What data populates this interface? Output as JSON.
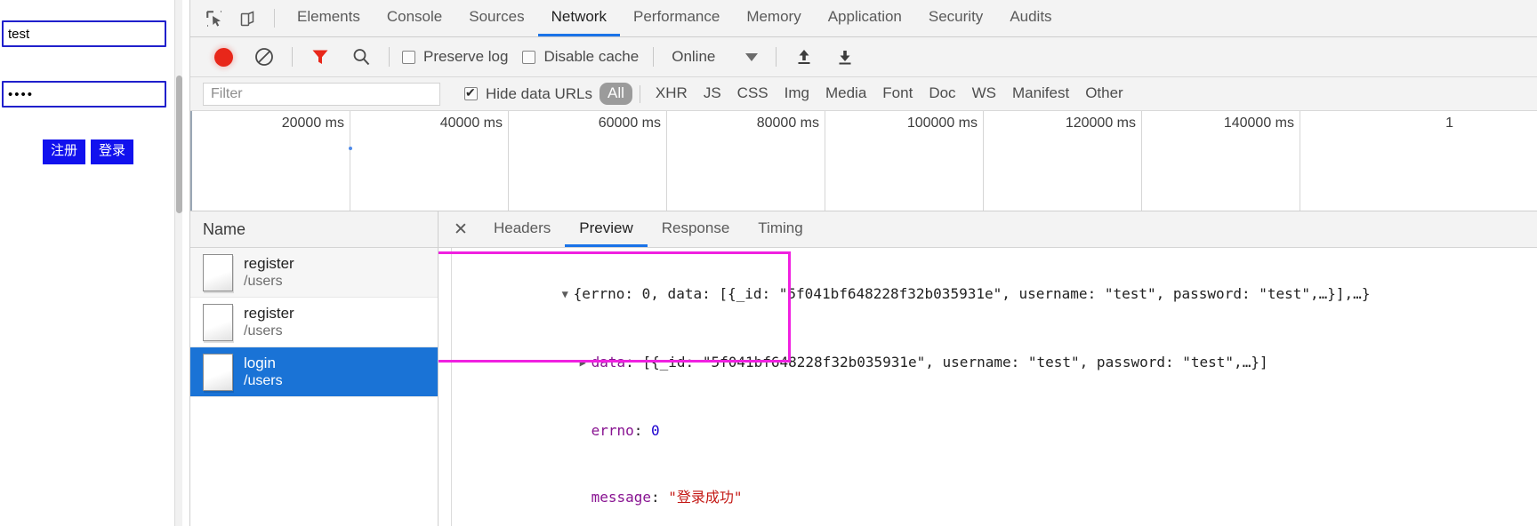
{
  "page": {
    "username_value": "test",
    "username_placeholder": "",
    "password_value": "••••",
    "password_placeholder": "",
    "register_button": "注册",
    "login_button": "登录"
  },
  "devtools": {
    "icons": {
      "inspect": "inspect-element-icon",
      "device": "device-toolbar-icon",
      "record": "record-icon",
      "clear": "clear-icon",
      "filter": "filter-funnel-icon",
      "search": "search-icon",
      "import": "import-har-icon",
      "export": "export-har-icon",
      "close": "close-icon"
    },
    "tabs": [
      {
        "label": "Elements",
        "active": false
      },
      {
        "label": "Console",
        "active": false
      },
      {
        "label": "Sources",
        "active": false
      },
      {
        "label": "Network",
        "active": true
      },
      {
        "label": "Performance",
        "active": false
      },
      {
        "label": "Memory",
        "active": false
      },
      {
        "label": "Application",
        "active": false
      },
      {
        "label": "Security",
        "active": false
      },
      {
        "label": "Audits",
        "active": false
      }
    ],
    "toolbar": {
      "preserve_log_label": "Preserve log",
      "preserve_log_checked": false,
      "disable_cache_label": "Disable cache",
      "disable_cache_checked": false,
      "throttle_value": "Online"
    },
    "filter_row": {
      "filter_placeholder": "Filter",
      "filter_value": "",
      "hide_data_urls_label": "Hide data URLs",
      "hide_data_urls_checked": true,
      "types": [
        {
          "label": "All",
          "active": true
        },
        {
          "label": "XHR",
          "active": false
        },
        {
          "label": "JS",
          "active": false
        },
        {
          "label": "CSS",
          "active": false
        },
        {
          "label": "Img",
          "active": false
        },
        {
          "label": "Media",
          "active": false
        },
        {
          "label": "Font",
          "active": false
        },
        {
          "label": "Doc",
          "active": false
        },
        {
          "label": "WS",
          "active": false
        },
        {
          "label": "Manifest",
          "active": false
        },
        {
          "label": "Other",
          "active": false
        }
      ]
    },
    "timeline": {
      "ticks": [
        "20000 ms",
        "40000 ms",
        "60000 ms",
        "80000 ms",
        "100000 ms",
        "120000 ms",
        "140000 ms",
        "1"
      ]
    },
    "requests": {
      "column_header": "Name",
      "rows": [
        {
          "name": "register",
          "path": "/users",
          "selected": false
        },
        {
          "name": "register",
          "path": "/users",
          "selected": false
        },
        {
          "name": "login",
          "path": "/users",
          "selected": true
        }
      ]
    },
    "detail": {
      "tabs": [
        {
          "label": "Headers",
          "active": false
        },
        {
          "label": "Preview",
          "active": true
        },
        {
          "label": "Response",
          "active": false
        },
        {
          "label": "Timing",
          "active": false
        }
      ],
      "preview": {
        "root_line": {
          "arrow": "▼",
          "text": "{errno: 0, data: [{_id: \"5f041bf648228f32b035931e\", username: \"test\", password: \"test\",…}],…}"
        },
        "data_line": {
          "arrow": "▶",
          "key": "data",
          "text": ": [{_id: \"5f041bf648228f32b035931e\", username: \"test\", password: \"test\",…}]"
        },
        "errno_line": {
          "key": "errno",
          "sep": ": ",
          "value": "0"
        },
        "message_line": {
          "key": "message",
          "sep": ": ",
          "value": "\"登录成功\""
        }
      }
    }
  },
  "colors": {
    "accent_blue": "#1a73e8",
    "selection_blue": "#1a73d6",
    "record_red": "#e8271a",
    "highlight_magenta": "#f020e0",
    "json_key_purple": "#881391",
    "json_number_blue": "#1c00cf",
    "json_string_red": "#c41a16",
    "page_button_blue": "#1111ee"
  }
}
